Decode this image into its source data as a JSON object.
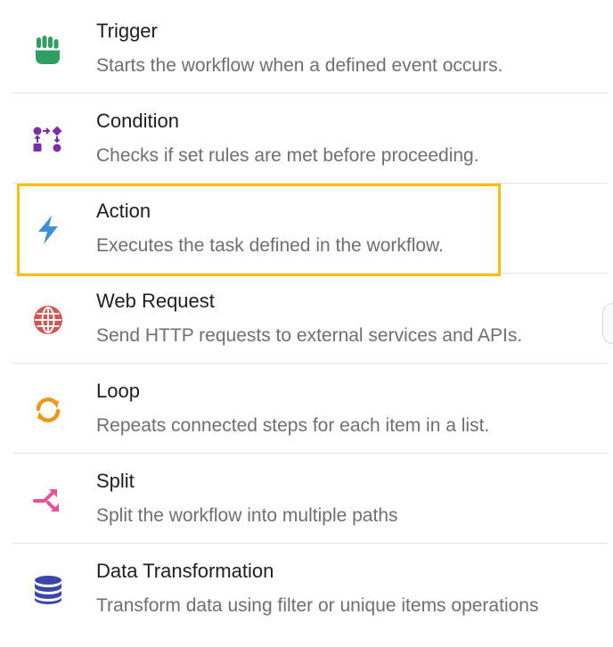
{
  "items": [
    {
      "title": "Trigger",
      "description": "Starts the workflow when a defined event occurs.",
      "icon": "hand-tap-icon",
      "color": "#2e9e62"
    },
    {
      "title": "Condition",
      "description": "Checks if set rules are met before proceeding.",
      "icon": "branch-shapes-icon",
      "color": "#7b2fa6"
    },
    {
      "title": "Action",
      "description": "Executes the task defined in the workflow.",
      "icon": "lightning-bolt-icon",
      "color": "#3d8fd6"
    },
    {
      "title": "Web Request",
      "description": "Send HTTP requests to external services and APIs.",
      "icon": "globe-icon",
      "color": "#d9534f"
    },
    {
      "title": "Loop",
      "description": "Repeats connected steps for each item in a list.",
      "icon": "loop-arrows-icon",
      "color": "#f0961e"
    },
    {
      "title": "Split",
      "description": "Split the workflow into multiple paths",
      "icon": "split-arrows-icon",
      "color": "#e8509a"
    },
    {
      "title": "Data Transformation",
      "description": "Transform data using filter or unique items operations",
      "icon": "database-icon",
      "color": "#3a46a8"
    }
  ],
  "highlight_color": "#f4c20d"
}
